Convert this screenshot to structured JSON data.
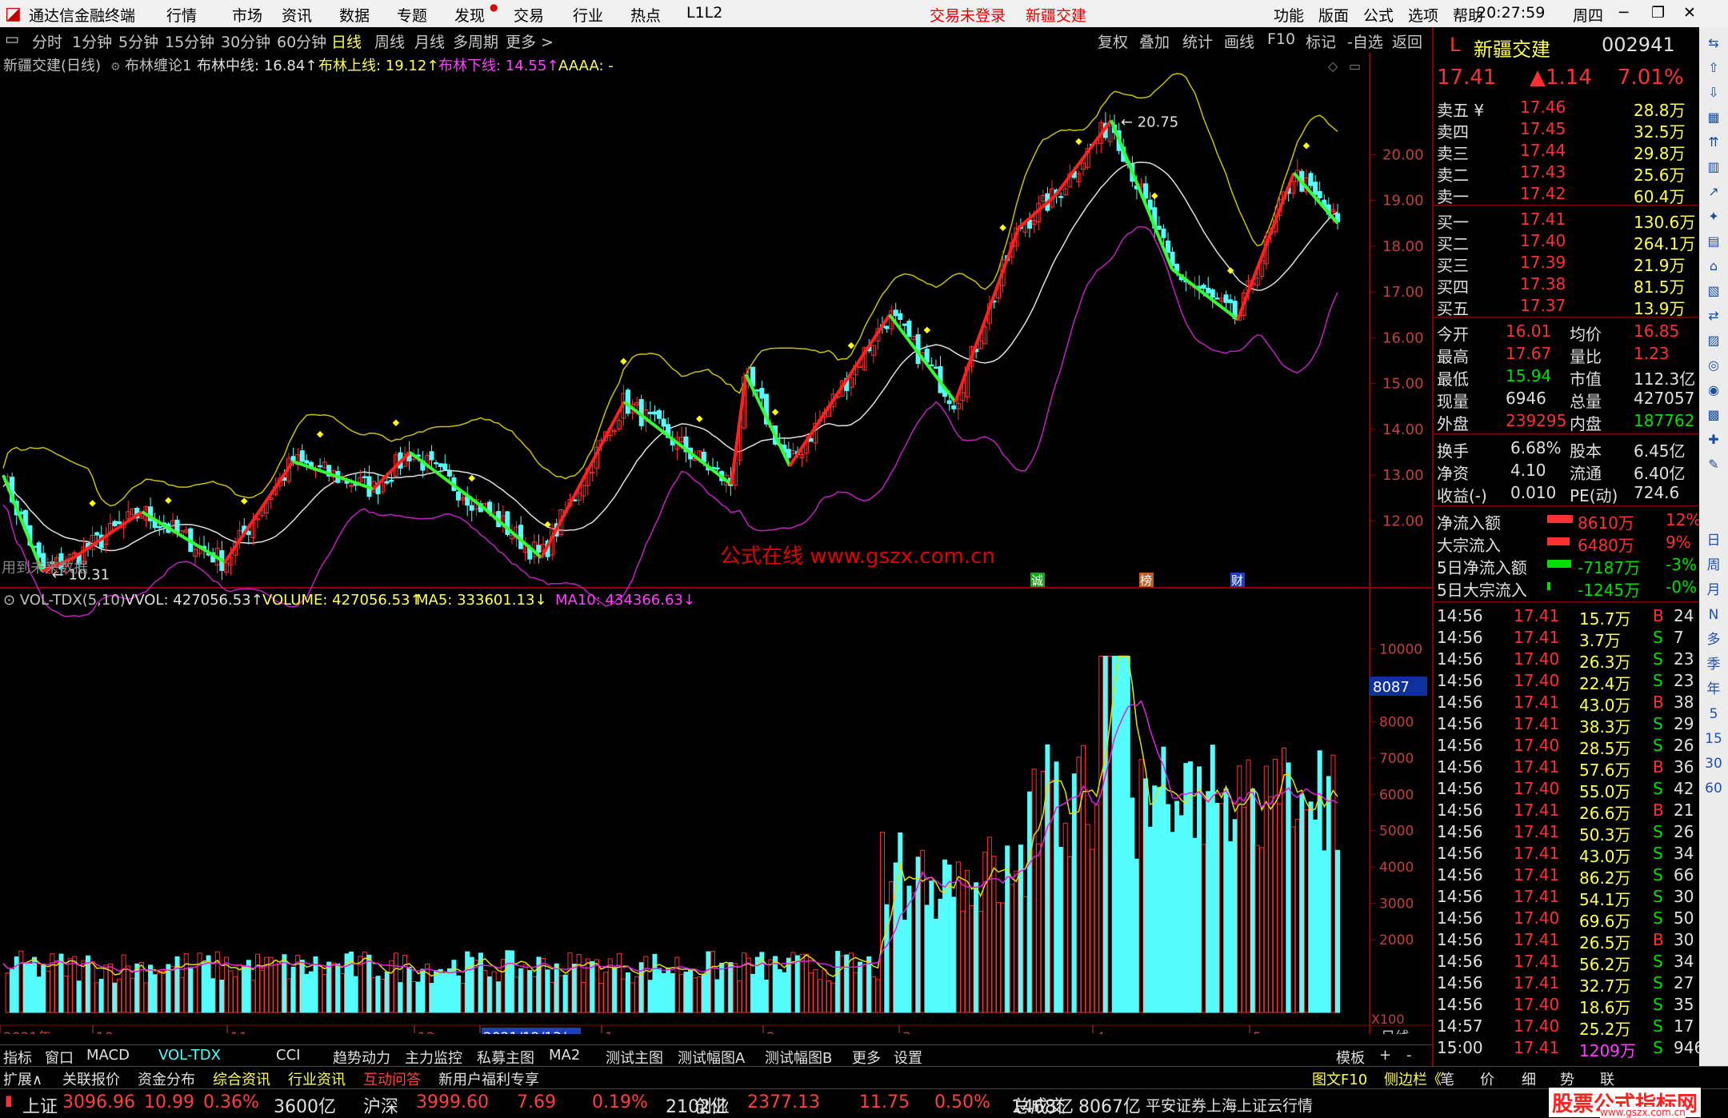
{
  "titlebar": {
    "app": "通达信金融终端",
    "menus": [
      "行情",
      "市场",
      "资讯",
      "数据",
      "专题",
      "发现",
      "交易",
      "行业",
      "热点",
      "L1L2"
    ],
    "status_login": "交易未登录",
    "stock_name": "新疆交建",
    "right_menus": [
      "功能",
      "版面",
      "公式",
      "选项",
      "帮助"
    ],
    "time": "20:27:59",
    "weekday": "周四"
  },
  "periods": [
    "分时",
    "1分钟",
    "5分钟",
    "15分钟",
    "30分钟",
    "60分钟",
    "日线",
    "周线",
    "月线",
    "多周期",
    "更多 >"
  ],
  "selected_period": "日线",
  "chart_tools": [
    "复权",
    "叠加",
    "统计",
    "画线",
    "F10",
    "标记",
    "-自选",
    "返回"
  ],
  "legend": {
    "title": "新疆交建(日线)",
    "indicator": "布林缠论1",
    "mid": "布林中线: 16.84↑",
    "up": "布林上线: 19.12↑",
    "down": "布林下线: 14.55↑",
    "aaaa": "AAAA: -"
  },
  "price_ticks": [
    "20.00",
    "19.00",
    "18.00",
    "17.00",
    "16.00",
    "15.00",
    "14.00",
    "13.00",
    "12.00"
  ],
  "annotations": {
    "high": "20.75",
    "low": "10.31",
    "future": "用到未来数据",
    "watermark": "公式在线  www.gszx.com.cn",
    "markers": [
      "诚",
      "榜",
      "财"
    ]
  },
  "vol_legend": {
    "name": "VOL-TDX(5,10)",
    "vvol": "VVOL: 427056.53↑",
    "volume": "VOLUME: 427056.53↑",
    "ma5": "MA5: 333601.13↓",
    "ma10": "MA10: 434366.63↓"
  },
  "vol_ticks": [
    "10000",
    "9000",
    "8000",
    "7000",
    "6000",
    "5000",
    "4000",
    "3000",
    "2000"
  ],
  "vol_current": "8087",
  "vol_unit": "X100",
  "date_axis": [
    "2021年",
    "10",
    "11",
    "12",
    "2021/12/13/一",
    "1",
    "2",
    "3",
    "4",
    "5"
  ],
  "date_axis_label": "日线",
  "tabs1": [
    "指标",
    "窗口",
    "MACD",
    "VOL-TDX",
    "CCI",
    "趋势动力",
    "主力监控",
    "私募主图",
    "MA2",
    "测试主图",
    "测试幅图A",
    "测试幅图B",
    "更多",
    "设置"
  ],
  "tabs1_right": [
    "模板",
    "+",
    "-"
  ],
  "tabs2": [
    "扩展∧",
    "关联报价",
    "资金分布",
    "综合资讯",
    "行业资讯",
    "互动问答",
    "新用户福利专享"
  ],
  "tabs2_right": [
    "图文F10",
    "侧边栏《",
    "笔",
    "价",
    "细",
    "势",
    "联"
  ],
  "indices": [
    {
      "name": "上证",
      "val": "3096.96",
      "chg": "10.99",
      "pct": "0.36%",
      "amt": "3600亿"
    },
    {
      "name": "沪深",
      "val": "3999.60",
      "chg": "7.69",
      "pct": "0.19%",
      "amt": "2102亿"
    },
    {
      "name": "创业",
      "val": "2377.13",
      "chg": "11.75",
      "pct": "0.50%",
      "amt": "1468亿"
    }
  ],
  "total_label": "总成交",
  "total_val": "8067亿",
  "broker": "平安证券上海上证云行情",
  "brand": "股票公式指标网",
  "brand_url": "www.gszx.com.cn",
  "quote": {
    "prefix": "L",
    "name": "新疆交建",
    "code": "002941",
    "price": "17.41",
    "chg": "▲1.14",
    "pct": "7.01%",
    "asks": [
      [
        "卖五 ¥",
        "17.46",
        "28.8万"
      ],
      [
        "卖四",
        "17.45",
        "32.5万"
      ],
      [
        "卖三",
        "17.44",
        "29.8万"
      ],
      [
        "卖二",
        "17.43",
        "25.6万"
      ],
      [
        "卖一",
        "17.42",
        "60.4万"
      ]
    ],
    "bids": [
      [
        "买一",
        "17.41",
        "130.6万"
      ],
      [
        "买二",
        "17.40",
        "264.1万"
      ],
      [
        "买三",
        "17.39",
        "21.9万"
      ],
      [
        "买四",
        "17.38",
        "81.5万"
      ],
      [
        "买五",
        "17.37",
        "13.9万"
      ]
    ],
    "stats": [
      [
        "今开",
        "16.01",
        "均价",
        "16.85"
      ],
      [
        "最高",
        "17.67",
        "量比",
        "1.23"
      ],
      [
        "最低",
        "15.94",
        "市值",
        "112.3亿"
      ],
      [
        "现量",
        "6946",
        "总量",
        "427057"
      ],
      [
        "外盘",
        "239295",
        "内盘",
        "187762"
      ]
    ],
    "fin": [
      [
        "换手",
        "6.68%",
        "股本",
        "6.45亿"
      ],
      [
        "净资",
        "4.10",
        "流通",
        "6.40亿"
      ],
      [
        "收益(-)",
        "0.010",
        "PE(动)",
        "724.6"
      ]
    ],
    "flow": [
      [
        "净流入额",
        "8610万",
        "12%"
      ],
      [
        "大宗流入",
        "6480万",
        "9%"
      ],
      [
        "5日净流入额",
        "-7187万",
        "-3%"
      ],
      [
        "5日大宗流入",
        "-1245万",
        "-0%"
      ]
    ],
    "trades": [
      [
        "14:56",
        "17.41",
        "15.7万",
        "B",
        "24"
      ],
      [
        "14:56",
        "17.41",
        "3.7万",
        "S",
        "7"
      ],
      [
        "14:56",
        "17.40",
        "26.3万",
        "S",
        "23"
      ],
      [
        "14:56",
        "17.40",
        "22.4万",
        "S",
        "23"
      ],
      [
        "14:56",
        "17.41",
        "43.0万",
        "B",
        "38"
      ],
      [
        "14:56",
        "17.41",
        "38.3万",
        "S",
        "29"
      ],
      [
        "14:56",
        "17.40",
        "28.5万",
        "S",
        "26"
      ],
      [
        "14:56",
        "17.41",
        "57.6万",
        "B",
        "36"
      ],
      [
        "14:56",
        "17.40",
        "55.0万",
        "S",
        "42"
      ],
      [
        "14:56",
        "17.41",
        "26.6万",
        "B",
        "21"
      ],
      [
        "14:56",
        "17.41",
        "50.3万",
        "S",
        "26"
      ],
      [
        "14:56",
        "17.41",
        "43.0万",
        "S",
        "34"
      ],
      [
        "14:56",
        "17.41",
        "86.2万",
        "S",
        "66"
      ],
      [
        "14:56",
        "17.41",
        "54.1万",
        "S",
        "30"
      ],
      [
        "14:56",
        "17.40",
        "69.6万",
        "S",
        "50"
      ],
      [
        "14:56",
        "17.41",
        "26.5万",
        "B",
        "30"
      ],
      [
        "14:56",
        "17.41",
        "56.2万",
        "S",
        "34"
      ],
      [
        "14:56",
        "17.41",
        "32.7万",
        "S",
        "27"
      ],
      [
        "14:56",
        "17.40",
        "18.6万",
        "S",
        "35"
      ],
      [
        "14:57",
        "17.40",
        "25.2万",
        "S",
        "17"
      ],
      [
        "15:00",
        "17.41",
        "1209万",
        "S",
        "946"
      ]
    ]
  },
  "side_labels": [
    "日",
    "周",
    "月",
    "N",
    "多",
    "季",
    "年",
    "5",
    "15",
    "30",
    "60"
  ],
  "chart_data": {
    "type": "candlestick+volume",
    "y_range": [
      10.0,
      21.0
    ],
    "zigzag": [
      [
        0,
        13.0
      ],
      [
        16,
        10.9
      ],
      [
        29,
        11.2
      ],
      [
        57,
        12.2
      ],
      [
        91,
        11.1
      ],
      [
        119,
        13.3
      ],
      [
        152,
        12.7
      ],
      [
        167,
        13.5
      ],
      [
        197,
        12.3
      ],
      [
        221,
        11.2
      ],
      [
        255,
        14.6
      ],
      [
        299,
        12.8
      ],
      [
        305,
        15.2
      ],
      [
        323,
        13.2
      ],
      [
        364,
        16.5
      ],
      [
        391,
        14.6
      ],
      [
        417,
        18.4
      ],
      [
        432,
        19.1
      ],
      [
        455,
        20.75
      ],
      [
        480,
        17.5
      ],
      [
        507,
        16.4
      ],
      [
        530,
        19.6
      ],
      [
        548,
        18.5
      ]
    ],
    "volume_range": [
      0,
      11000
    ]
  }
}
